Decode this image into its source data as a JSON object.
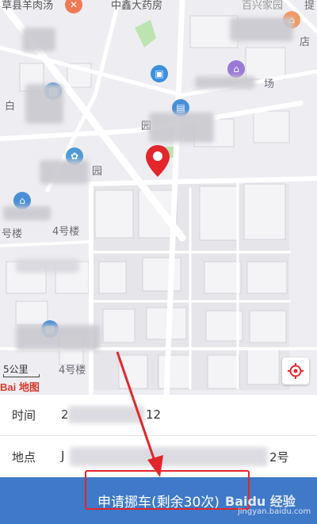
{
  "map": {
    "labels": {
      "top_left": "草县羊肉汤",
      "top_mid": "中鑫大药房",
      "top_right": "百兴家园",
      "shop_right": "店",
      "road_right": "提",
      "mall": "场",
      "lane_left": "白",
      "lane_mid": "园",
      "area_mid": "园",
      "bldg_4a": "号楼",
      "bldg_4b": "4号楼",
      "bldg_4c": "4号楼"
    },
    "scale_label": "5公里",
    "logo_text": "Bai 地图"
  },
  "info": {
    "time_label": "时间",
    "time_value_prefix": "2",
    "time_value_suffix": "12",
    "place_label": "地点",
    "place_value_prefix": "J",
    "place_value_suffix": "2号"
  },
  "action": {
    "button_label": "申请挪车(剩余30次)"
  },
  "watermark": {
    "brand": "Baidu 经验",
    "url": "jingyan.baidu.com"
  },
  "colors": {
    "button_bg": "#3f79c7",
    "pin": "#e3262c",
    "annotation": "#e3262c"
  }
}
